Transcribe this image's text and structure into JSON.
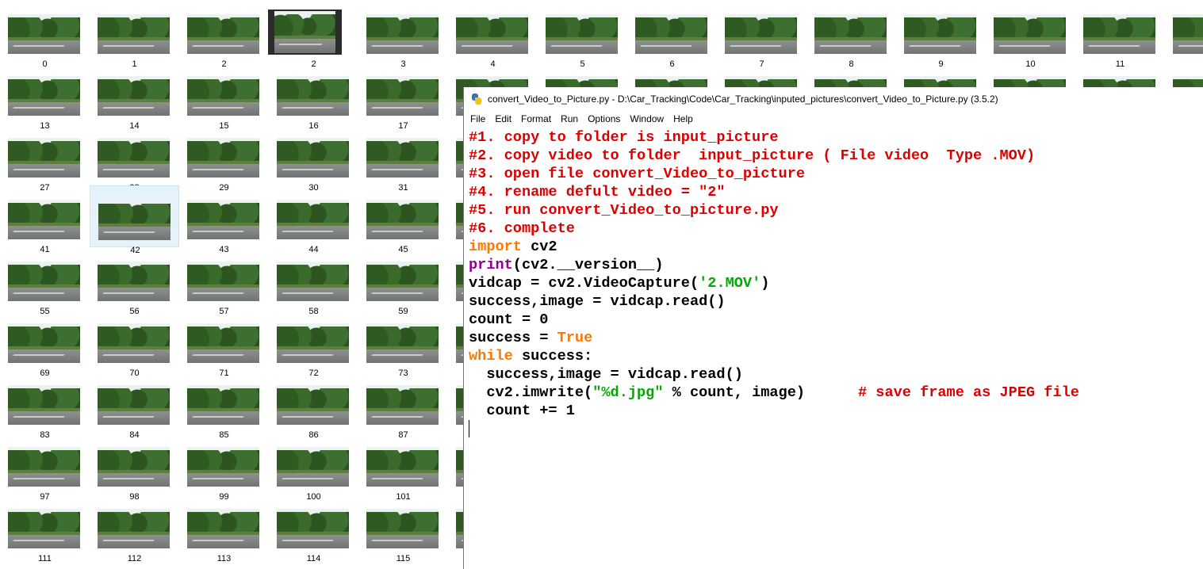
{
  "explorer": {
    "tiles": [
      {
        "label": "0"
      },
      {
        "label": "1"
      },
      {
        "label": "2"
      },
      {
        "label": "2",
        "kind": "video"
      },
      {
        "label": "3"
      },
      {
        "label": "4"
      },
      {
        "label": "5"
      },
      {
        "label": "6"
      },
      {
        "label": "7"
      },
      {
        "label": "8"
      },
      {
        "label": "9"
      },
      {
        "label": "10"
      },
      {
        "label": "11"
      },
      {
        "label": ""
      },
      {
        "label": "13"
      },
      {
        "label": "14"
      },
      {
        "label": "15"
      },
      {
        "label": "16"
      },
      {
        "label": "17"
      },
      {
        "label": "27"
      },
      {
        "label": "28"
      },
      {
        "label": "29"
      },
      {
        "label": "30"
      },
      {
        "label": "31"
      },
      {
        "label": "41"
      },
      {
        "label": "42",
        "selected": true
      },
      {
        "label": "43"
      },
      {
        "label": "44"
      },
      {
        "label": "45"
      },
      {
        "label": "55"
      },
      {
        "label": "56"
      },
      {
        "label": "57"
      },
      {
        "label": "58"
      },
      {
        "label": "59"
      },
      {
        "label": "69"
      },
      {
        "label": "70"
      },
      {
        "label": "71"
      },
      {
        "label": "72"
      },
      {
        "label": "73"
      },
      {
        "label": "83"
      },
      {
        "label": "84"
      },
      {
        "label": "85"
      },
      {
        "label": "86"
      },
      {
        "label": "87"
      },
      {
        "label": "97"
      },
      {
        "label": "98"
      },
      {
        "label": "99"
      },
      {
        "label": "100"
      },
      {
        "label": "101"
      },
      {
        "label": "111"
      },
      {
        "label": "112"
      },
      {
        "label": "113"
      },
      {
        "label": "114"
      },
      {
        "label": "115"
      }
    ]
  },
  "idle": {
    "title": "convert_Video_to_Picture.py - D:\\Car_Tracking\\Code\\Car_Tracking\\inputed_pictures\\convert_Video_to_Picture.py (3.5.2)",
    "icon": "python-file-icon",
    "menu": [
      "File",
      "Edit",
      "Format",
      "Run",
      "Options",
      "Window",
      "Help"
    ],
    "code_lines": [
      [
        {
          "t": "#1. copy to folder is input_picture",
          "c": "cm"
        }
      ],
      [
        {
          "t": "#2. copy video to folder  input_picture ( File video  Type .MOV)",
          "c": "cm"
        }
      ],
      [
        {
          "t": "#3. open file convert_Video_to_picture",
          "c": "cm"
        }
      ],
      [
        {
          "t": "#4. rename defult video = \"2\"",
          "c": "cm"
        }
      ],
      [
        {
          "t": "#5. run convert_Video_to_picture.py",
          "c": "cm"
        }
      ],
      [
        {
          "t": "#6. complete",
          "c": "cm"
        }
      ],
      [
        {
          "t": "import",
          "c": "kw"
        },
        {
          "t": " cv2",
          "c": ""
        }
      ],
      [
        {
          "t": "print",
          "c": "bi"
        },
        {
          "t": "(cv2.__version__)",
          "c": ""
        }
      ],
      [
        {
          "t": "vidcap = cv2.VideoCapture(",
          "c": ""
        },
        {
          "t": "'2.MOV'",
          "c": "st"
        },
        {
          "t": ")",
          "c": ""
        }
      ],
      [
        {
          "t": "success,image = vidcap.read()",
          "c": ""
        }
      ],
      [
        {
          "t": "count = 0",
          "c": ""
        }
      ],
      [
        {
          "t": "success = ",
          "c": ""
        },
        {
          "t": "True",
          "c": "kw"
        }
      ],
      [
        {
          "t": "while",
          "c": "kw"
        },
        {
          "t": " success:",
          "c": ""
        }
      ],
      [
        {
          "t": "  success,image = vidcap.read()",
          "c": ""
        }
      ],
      [
        {
          "t": "  cv2.imwrite(",
          "c": ""
        },
        {
          "t": "\"%d.jpg\"",
          "c": "st"
        },
        {
          "t": " % count, image)      ",
          "c": ""
        },
        {
          "t": "# save frame as JPEG file",
          "c": "cm"
        }
      ],
      [
        {
          "t": "  count += 1",
          "c": ""
        }
      ],
      [
        {
          "t": "",
          "c": "",
          "caret": true
        }
      ]
    ]
  }
}
